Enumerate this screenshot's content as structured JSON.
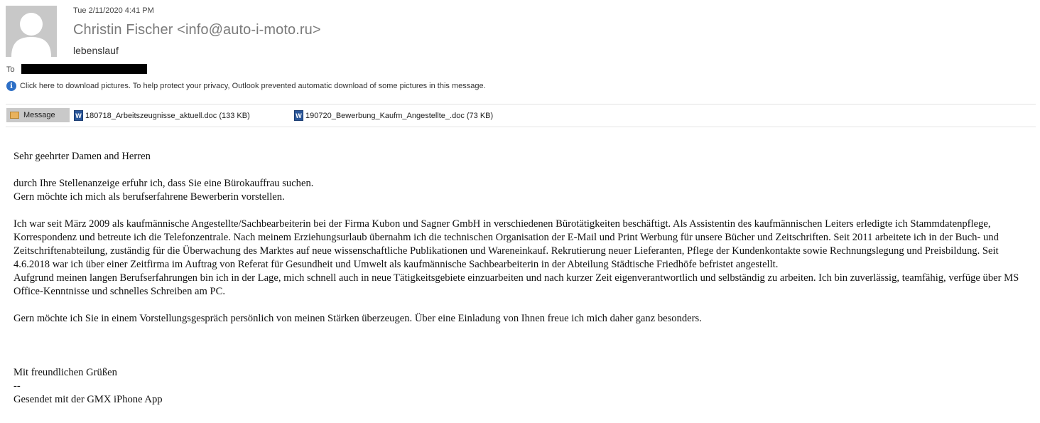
{
  "email": {
    "date": "Tue 2/11/2020 4:41 PM",
    "sender": "Christin Fischer <info@auto-i-moto.ru>",
    "subject": "lebenslauf",
    "to_label": "To",
    "info_bar": "Click here to download pictures. To help protect your privacy, Outlook prevented automatic download of some pictures in this message."
  },
  "tabs": {
    "message_label": "Message",
    "attachments": [
      {
        "name": "180718_Arbeitszeugnisse_aktuell.doc (133 KB)",
        "icon": "word-doc-icon"
      },
      {
        "name": "190720_Bewerbung_Kaufm_Angestellte_.doc (73 KB)",
        "icon": "word-doc-icon"
      }
    ]
  },
  "body": {
    "greeting": "Sehr geehrter Damen and Herren",
    "p1_line1": "durch Ihre Stellenanzeige erfuhr ich, dass Sie eine Bürokauffrau suchen.",
    "p1_line2": "Gern möchte ich mich als berufserfahrene Bewerberin vorstellen.",
    "p2": "Ich war seit März 2009 als kaufmännische Angestellte/Sachbearbeiterin bei der Firma Kubon und Sagner GmbH in verschiedenen Bürotätigkeiten beschäftigt. Als Assistentin des kaufmännischen Leiters erledigte ich Stammdatenpflege, Korrespondenz und betreute ich die Telefonzentrale. Nach meinem Erziehungsurlaub übernahm ich die technischen Organisation der E-Mail und Print Werbung für unsere Bücher und Zeitschriften. Seit 2011 arbeitete ich in der Buch- und Zeitschriftenabteilung, zuständig für die Überwachung des Marktes auf neue wissenschaftliche Publikationen und Wareneinkauf. Rekrutierung neuer Lieferanten, Pflege der Kundenkontakte sowie Rechnungslegung und Preisbildung. Seit 4.6.2018 war ich über einer Zeitfirma im Auftrag von Referat für Gesundheit und Umwelt als kaufmännische Sachbearbeiterin in der Abteilung Städtische Friedhöfe befristet angestellt.",
    "p3": "Aufgrund meinen langen Berufserfahrungen bin ich in der Lage, mich schnell auch in neue Tätigkeitsgebiete einzuarbeiten und nach kurzer Zeit eigenverantwortlich und selbständig zu arbeiten. Ich bin zuverlässig, teamfähig, verfüge über MS Office-Kenntnisse und schnelles Schreiben am PC.",
    "p4": "Gern möchte ich Sie in einem Vorstellungsgespräch persönlich von meinen Stärken überzeugen. Über eine Einladung von Ihnen freue ich mich daher ganz besonders.",
    "closing": "Mit freundlichen Grüßen",
    "sig_sep": "--",
    "signature": "Gesendet mit der GMX iPhone App"
  }
}
